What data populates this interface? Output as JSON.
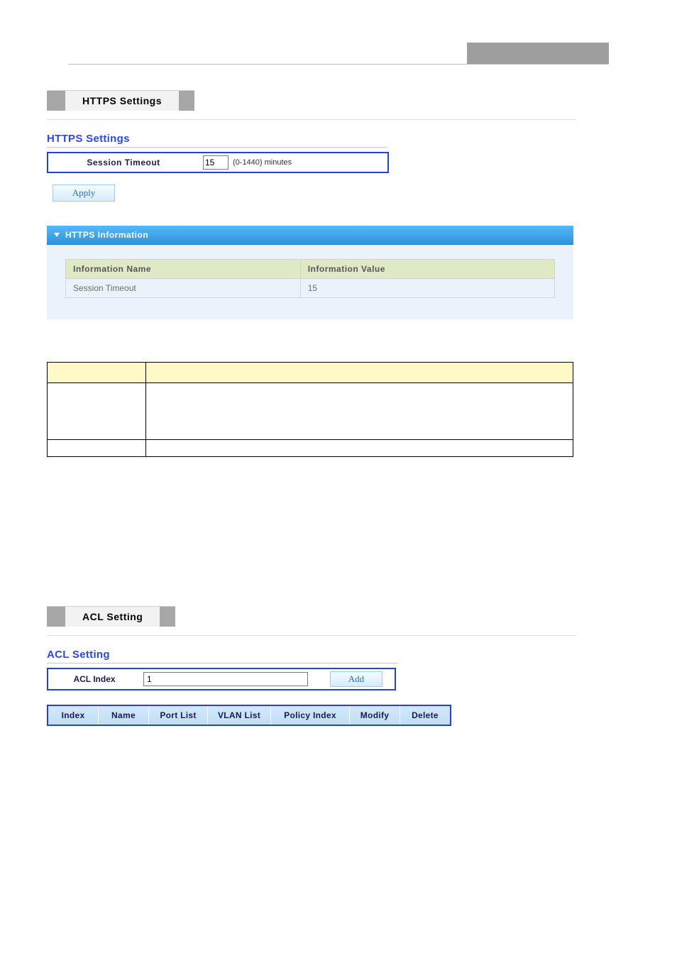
{
  "https": {
    "section_title": "HTTPS Settings",
    "form_title": "HTTPS Settings",
    "session_timeout_label": "Session Timeout",
    "session_timeout_value": "15",
    "session_timeout_hint": "(0-1440) minutes",
    "apply_label": "Apply",
    "info_panel_title": "HTTPS Information",
    "info_table_headers": {
      "name": "Information Name",
      "value": "Information Value"
    },
    "info_rows": [
      {
        "name": "Session Timeout",
        "value": "15"
      }
    ]
  },
  "acl": {
    "section_title": "ACL Setting",
    "form_title": "ACL Setting",
    "index_label": "ACL Index",
    "index_value": "1",
    "add_label": "Add",
    "list_headers": [
      "Index",
      "Name",
      "Port List",
      "VLAN List",
      "Policy Index",
      "Modify",
      "Delete"
    ]
  }
}
